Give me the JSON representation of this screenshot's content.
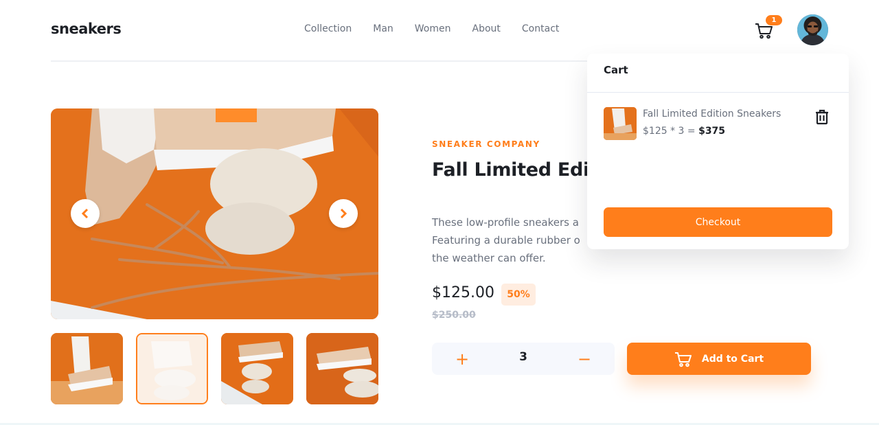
{
  "brand": {
    "logo": "sneakers",
    "accent": "#ff7e1b"
  },
  "nav": {
    "items": [
      "Collection",
      "Man",
      "Women",
      "About",
      "Contact"
    ]
  },
  "header": {
    "cart_icon": "cart-icon",
    "cart_count": "1"
  },
  "product": {
    "company": "SNEAKER COMPANY",
    "title": "Fall Limited Editio",
    "description_lines": [
      "These low-profile sneakers a",
      "Featuring a durable rubber o",
      "the weather can offer."
    ],
    "price": "$125.00",
    "discount": "50%",
    "original_price": "$250.00"
  },
  "quantity": {
    "plus": "+",
    "value": "3",
    "minus": "−"
  },
  "actions": {
    "add_to_cart": "Add to Cart"
  },
  "cart": {
    "heading": "Cart",
    "item_name": "Fall Limited Edition Sneakers",
    "item_calc": "$125 * 3 = ",
    "item_total": "$375",
    "checkout": "Checkout"
  }
}
